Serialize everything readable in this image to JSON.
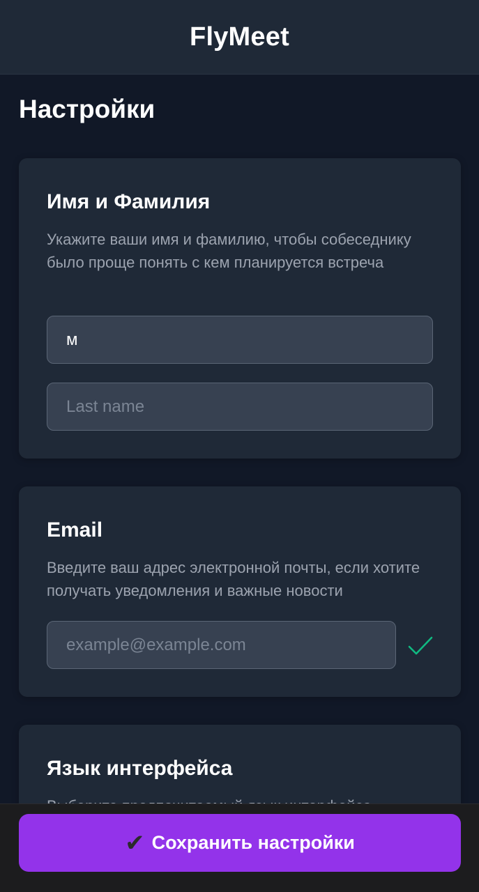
{
  "header": {
    "title": "FlyMeet"
  },
  "page": {
    "title": "Настройки"
  },
  "name_section": {
    "title": "Имя и Фамилия",
    "description": "Укажите ваши имя и фамилию, чтобы собеседнику было проще понять с кем планируется встреча",
    "first_name_value": "м",
    "last_name_placeholder": "Last name"
  },
  "email_section": {
    "title": "Email",
    "description": "Введите ваш адрес электронной почты, если хотите получать уведомления и важные новости",
    "email_placeholder": "example@example.com",
    "valid_icon": "check-icon",
    "valid_color": "#10b981"
  },
  "language_section": {
    "title": "Язык интерфейса",
    "description": "Выберите предпочитаемый язык интерфейса"
  },
  "footer": {
    "save_icon": "✔",
    "save_label": "Сохранить настройки"
  },
  "colors": {
    "background": "#111827",
    "card": "#1f2937",
    "input": "#374151",
    "accent": "#9333ea"
  }
}
